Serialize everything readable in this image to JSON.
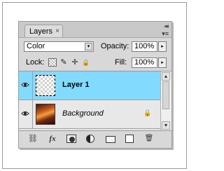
{
  "panel": {
    "tab_label": "Layers",
    "tab_close": "×",
    "collapse_glyph": "◂◂",
    "menu_glyph": "▾≡"
  },
  "blend_mode": {
    "selected": "Color",
    "arrow": "▾"
  },
  "opacity": {
    "label": "Opacity:",
    "value": "100%",
    "stepper": "▸"
  },
  "lock": {
    "label": "Lock:",
    "icons": [
      "lock-transparent-pixels-icon",
      "lock-image-pixels-icon",
      "lock-position-icon",
      "lock-all-icon"
    ],
    "brush_glyph": "✎",
    "move_glyph": "✛",
    "padlock_glyph": "🔒"
  },
  "fill": {
    "label": "Fill:",
    "value": "100%",
    "stepper": "▸"
  },
  "layers": [
    {
      "name": "Layer 1",
      "visible": true,
      "selected": true,
      "locked": false
    },
    {
      "name": "Background",
      "visible": true,
      "selected": false,
      "locked": true
    }
  ],
  "bottom_icons": [
    "link-layers-icon",
    "add-layer-style-icon",
    "add-mask-icon",
    "new-adjustment-layer-icon",
    "new-group-icon",
    "new-layer-icon",
    "delete-layer-icon"
  ],
  "bottom": {
    "fx_label": "fx",
    "link_glyph": "⛓",
    "trash_glyph": "🗑"
  },
  "scroll": {
    "up": "▲",
    "down": "▼"
  },
  "accent": {
    "selected_row": "#82dbff",
    "highlight": "#ffff00"
  }
}
